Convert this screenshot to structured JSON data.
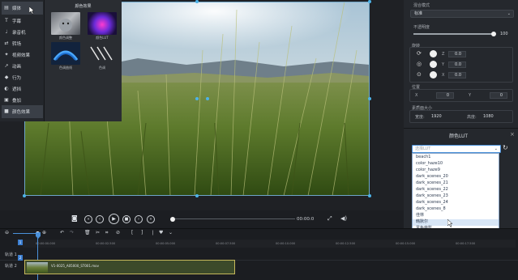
{
  "left_menu": {
    "items": [
      {
        "label": "媒体",
        "icon": "folder-icon"
      },
      {
        "label": "字幕",
        "icon": "text-t-icon"
      },
      {
        "label": "录音机",
        "icon": "mic-icon"
      },
      {
        "label": "转场",
        "icon": "transition-icon"
      },
      {
        "label": "视频效果",
        "icon": "video-effect-icon"
      },
      {
        "label": "动画",
        "icon": "animation-icon"
      },
      {
        "label": "行为",
        "icon": "behavior-icon"
      },
      {
        "label": "遮挡",
        "icon": "mask-icon"
      },
      {
        "label": "叠加",
        "icon": "overlay-icon"
      },
      {
        "label": "颜色效果",
        "icon": "color-effect-icon"
      }
    ]
  },
  "effects_panel": {
    "title": "颜色效果",
    "effects": [
      {
        "label": "颜色调整"
      },
      {
        "label": "颜色LUT"
      },
      {
        "label": "色调曲线"
      },
      {
        "label": "色调"
      }
    ]
  },
  "right_panel": {
    "blend_label": "混合模式",
    "blend_value": "标准",
    "opacity_label": "不透明度",
    "opacity_value": "100",
    "opacity_fraction": 1.0,
    "rotate_label": "旋转",
    "rotations": [
      {
        "axis": "Z",
        "value": "0.0"
      },
      {
        "axis": "Y",
        "value": "0.0"
      },
      {
        "axis": "X",
        "value": "0.0"
      }
    ],
    "position_label": "位置",
    "pos_x_label": "X",
    "pos_x_value": "0",
    "pos_y_label": "Y",
    "pos_y_value": "0",
    "size_label": "素质面大小",
    "width_label": "宽度:",
    "width_value": "1920",
    "height_label": "高度:",
    "height_value": "1080",
    "lut_header": "颜色LUT",
    "lut_select_placeholder": "选择LUT",
    "lut_options": [
      "beach1",
      "color_haze10",
      "color_haze9",
      "dark_scenes_20",
      "dark_scenes_21",
      "dark_scenes_22",
      "dark_scenes_23",
      "dark_scenes_24",
      "dark_scenes_8",
      "佳林",
      "韩默尔",
      "黑色电影",
      "蜡笔",
      "胶片",
      "冷色",
      "浅黄色",
      "闪亮",
      "重照",
      "闪烁"
    ],
    "lut_hover_index": 10
  },
  "transport": {
    "time": "00:00:0"
  },
  "timeline": {
    "ruler": [
      "00:00:00.000",
      "00:00:02.500",
      "00:00:05.000",
      "00:00:07.500",
      "00:00:10.000",
      "00:00:12.500",
      "00:00:15.000",
      "00:00:17.500"
    ],
    "tracks": [
      {
        "label": "轨道 1",
        "number": "1"
      },
      {
        "label": "轨道 2",
        "number": "2"
      }
    ],
    "clip_name": "V1-0025_A05000_ST001.mov"
  }
}
